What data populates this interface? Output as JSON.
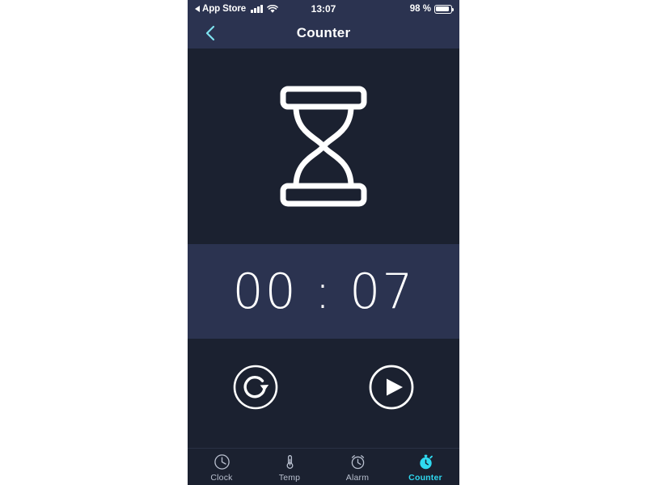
{
  "colors": {
    "screen_bg": "#1b2130",
    "panel_bg": "#2b3350",
    "accent": "#2fd9f0",
    "back_chevron": "#7fe3f0",
    "text": "#ffffff",
    "tab_inactive": "#b9c0cf"
  },
  "status_bar": {
    "back_app_label": "App Store",
    "signal_icon": "cellular-signal-icon",
    "wifi_icon": "wifi-icon",
    "time": "13:07",
    "battery_percent": "98 %",
    "battery_icon": "battery-icon"
  },
  "nav_bar": {
    "back_icon": "chevron-left-icon",
    "title": "Counter"
  },
  "main": {
    "hero_icon": "hourglass-icon",
    "timer_value": "00 : 07"
  },
  "controls": [
    {
      "name": "reset-button",
      "icon": "reset-circular-arrow-icon"
    },
    {
      "name": "play-button",
      "icon": "play-circle-icon"
    }
  ],
  "tab_bar": {
    "items": [
      {
        "label": "Clock",
        "icon": "clock-icon",
        "active": false
      },
      {
        "label": "Temp",
        "icon": "thermometer-icon",
        "active": false
      },
      {
        "label": "Alarm",
        "icon": "alarm-clock-icon",
        "active": false
      },
      {
        "label": "Counter",
        "icon": "stopwatch-icon",
        "active": true
      }
    ]
  }
}
